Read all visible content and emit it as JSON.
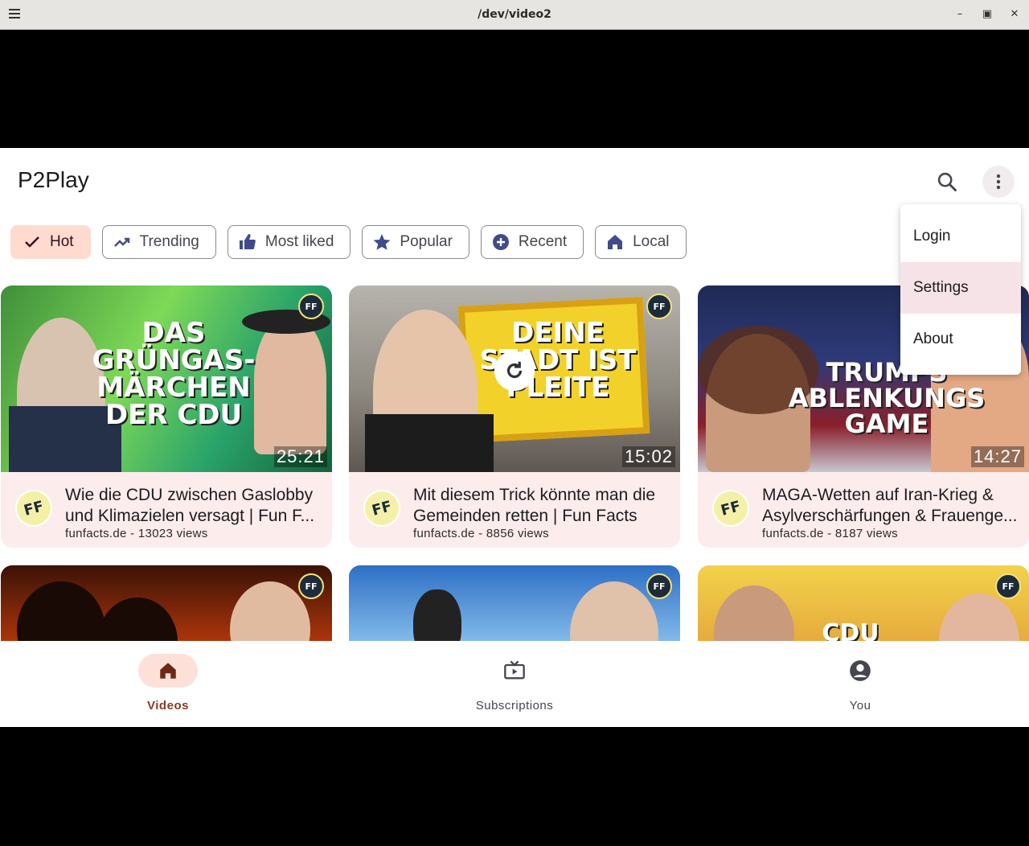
{
  "window": {
    "title": "/dev/video2"
  },
  "app": {
    "title": "P2Play"
  },
  "chips": [
    {
      "label": "Hot",
      "icon": "check-icon",
      "selected": true
    },
    {
      "label": "Trending",
      "icon": "trending-up-icon"
    },
    {
      "label": "Most liked",
      "icon": "thumb-up-icon"
    },
    {
      "label": "Popular",
      "icon": "star-icon"
    },
    {
      "label": "Recent",
      "icon": "add-circle-icon"
    },
    {
      "label": "Local",
      "icon": "home-icon"
    }
  ],
  "menu": {
    "items": [
      "Login",
      "Settings",
      "About"
    ]
  },
  "videos": [
    {
      "title": "Wie die CDU zwischen Gaslobby und Klimazielen versagt  | Fun F...",
      "subtitle": "funfacts.de - 13023 views",
      "duration": "25:21",
      "art": "DAS GRÜNGAS-MÄRCHEN DER CDU"
    },
    {
      "title": "Mit diesem Trick könnte man die Gemeinden retten | Fun Facts",
      "subtitle": "funfacts.de - 8856 views",
      "duration": "15:02",
      "art": "DEINE STADT IST PLEITE"
    },
    {
      "title": "MAGA-Wetten auf Iran-Krieg & Asylverschärfungen & Frauenge...",
      "subtitle": "funfacts.de - 8187 views",
      "duration": "14:27",
      "art": "TRUMPS ABLENKUNGS GAME"
    },
    {
      "title": "",
      "subtitle": "",
      "duration": "",
      "art": ""
    },
    {
      "title": "",
      "subtitle": "",
      "duration": "",
      "art": ""
    },
    {
      "title": "",
      "subtitle": "",
      "duration": "",
      "art": "CDU"
    }
  ],
  "badge": "FF",
  "nav": [
    {
      "label": "Videos",
      "icon": "home-icon",
      "active": true
    },
    {
      "label": "Subscriptions",
      "icon": "tv-icon"
    },
    {
      "label": "You",
      "icon": "account-icon"
    }
  ],
  "colors": {
    "accent": "#8b3a1f",
    "chip_selected": "#ffdbcf",
    "card_bg": "#fdecec"
  }
}
